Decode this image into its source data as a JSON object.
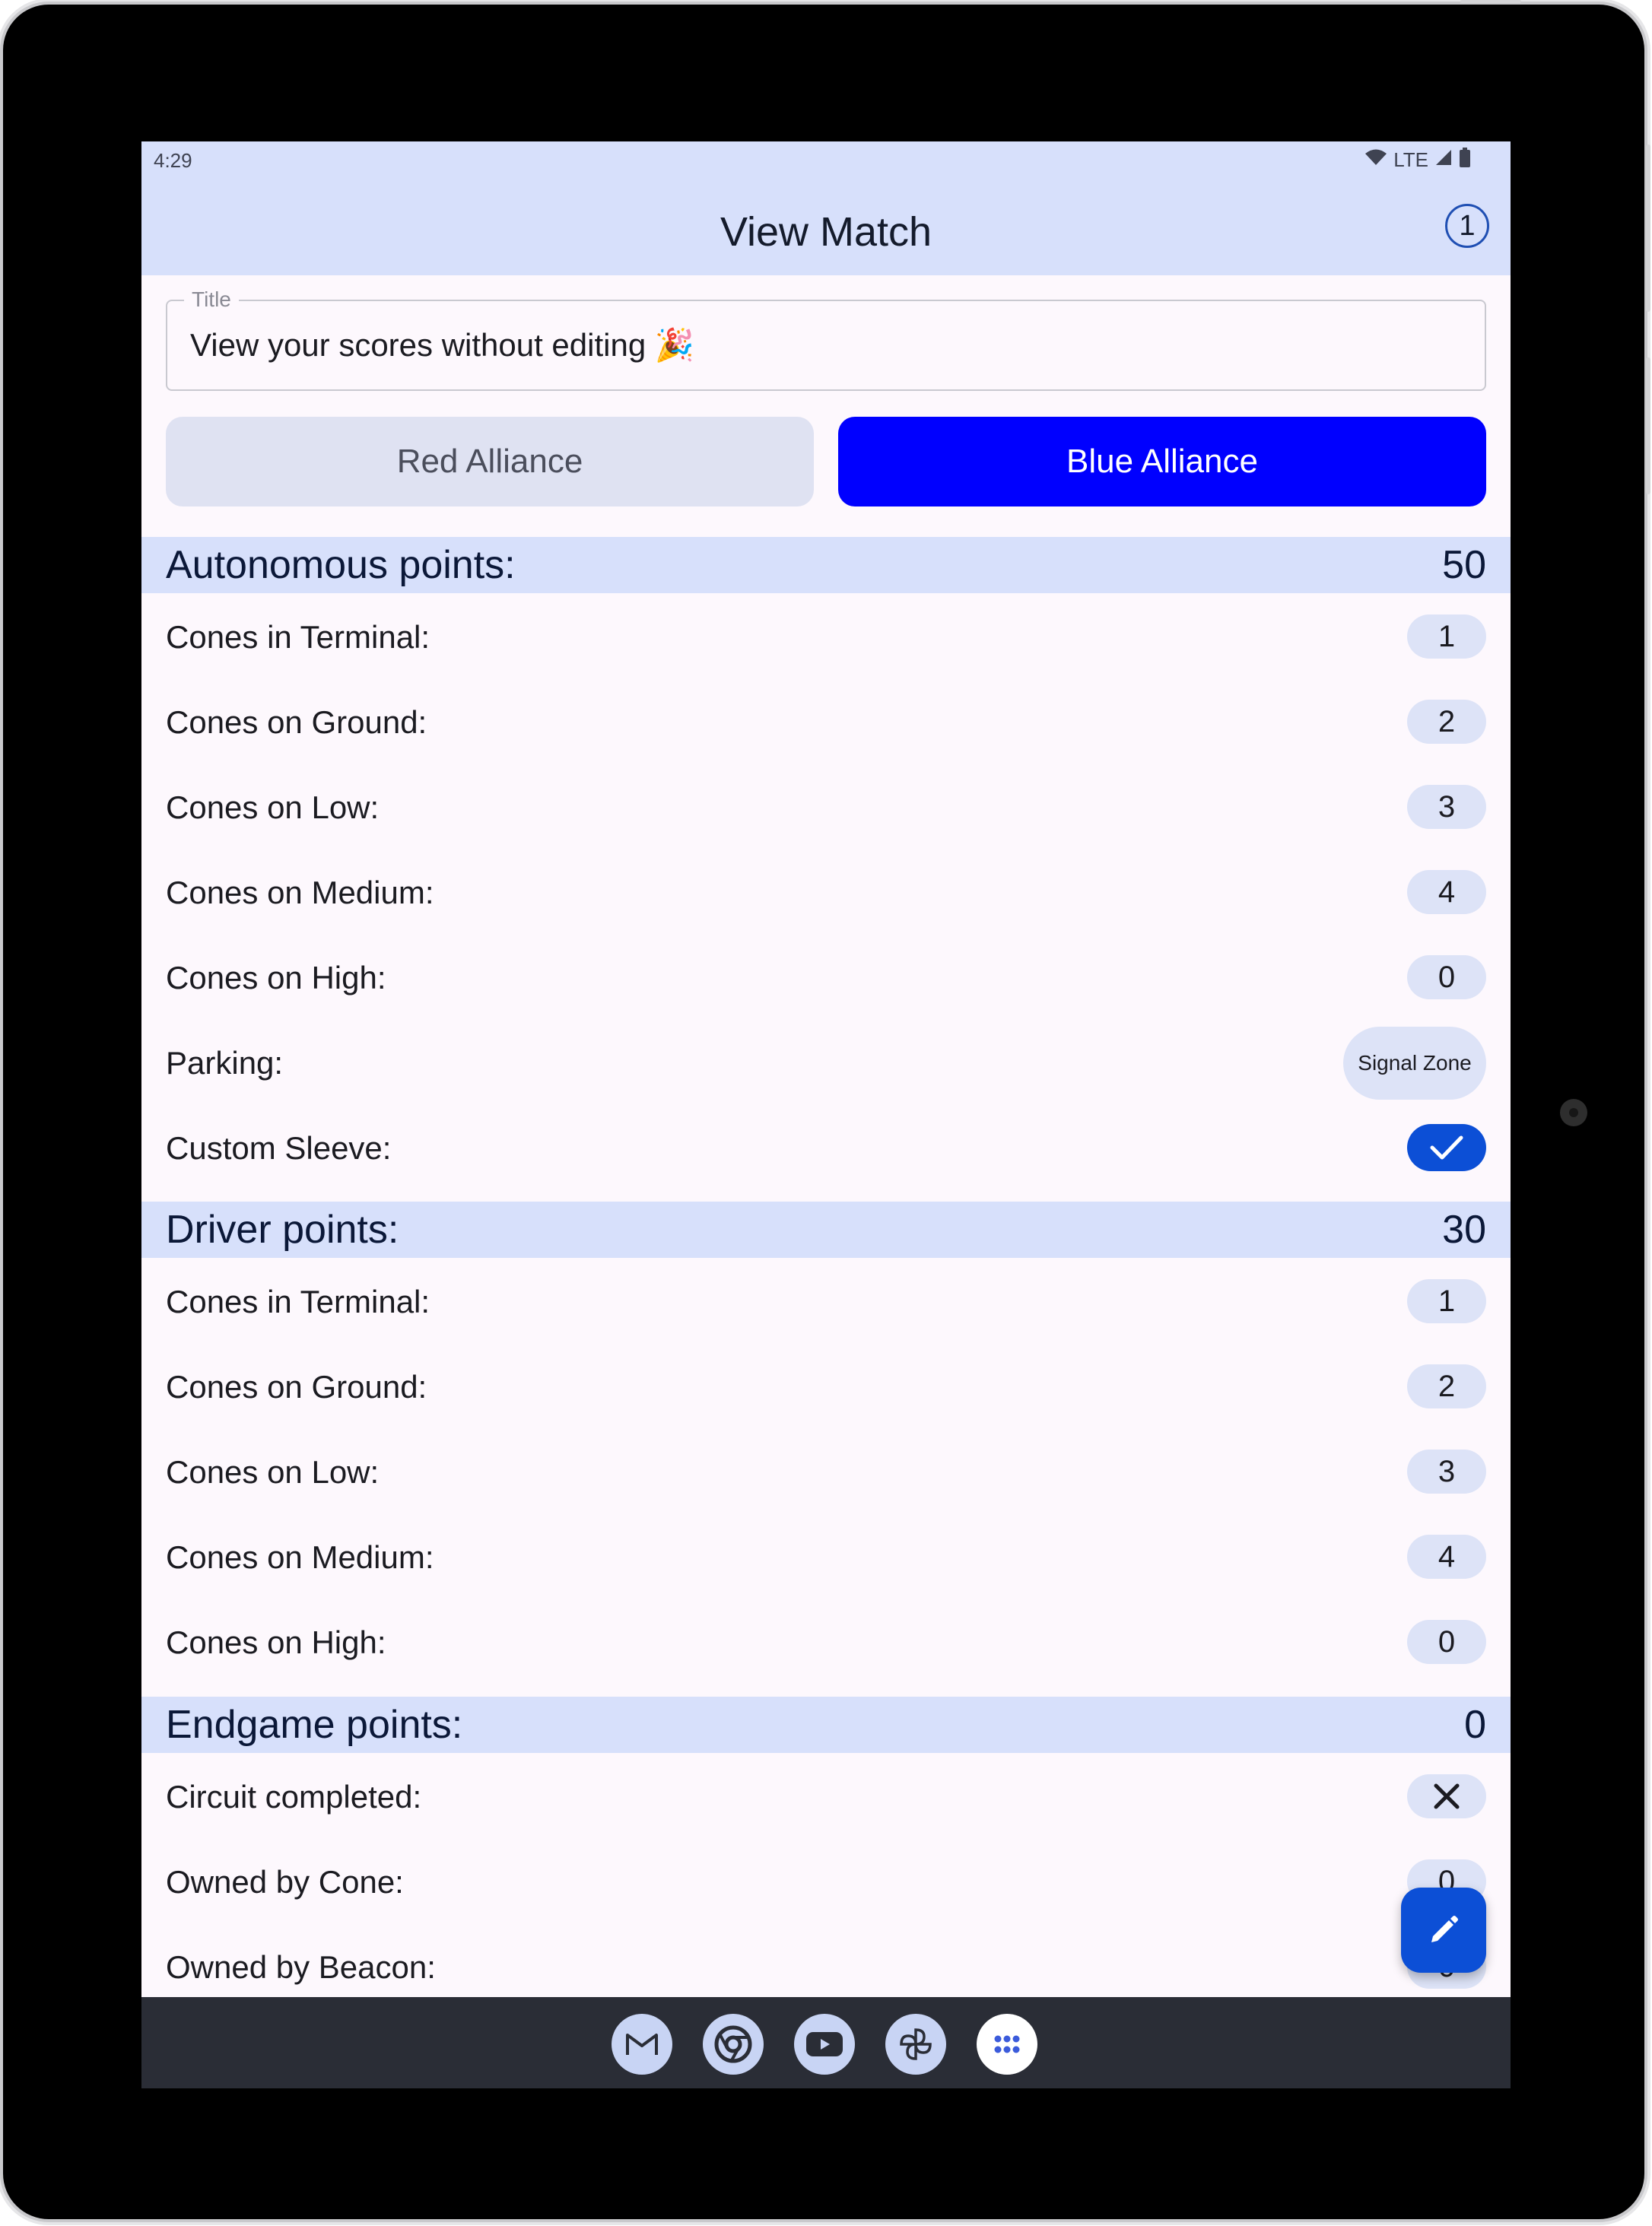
{
  "status": {
    "time": "4:29",
    "network": "LTE"
  },
  "appbar": {
    "title": "View Match",
    "badge": "1"
  },
  "title_field": {
    "label": "Title",
    "value": "View your scores without editing 🎉"
  },
  "alliance": {
    "red_label": "Red Alliance",
    "blue_label": "Blue Alliance",
    "selected": "Blue Alliance"
  },
  "autonomous": {
    "title": "Autonomous points:",
    "total": "50",
    "rows": [
      {
        "label": "Cones in Terminal:",
        "value": "1"
      },
      {
        "label": "Cones on Ground:",
        "value": "2"
      },
      {
        "label": "Cones on Low:",
        "value": "3"
      },
      {
        "label": "Cones on Medium:",
        "value": "4"
      },
      {
        "label": "Cones on High:",
        "value": "0"
      },
      {
        "label": "Parking:",
        "value": "Signal Zone"
      },
      {
        "label": "Custom Sleeve:",
        "value": "checked"
      }
    ]
  },
  "driver": {
    "title": "Driver points:",
    "total": "30",
    "rows": [
      {
        "label": "Cones in Terminal:",
        "value": "1"
      },
      {
        "label": "Cones on Ground:",
        "value": "2"
      },
      {
        "label": "Cones on Low:",
        "value": "3"
      },
      {
        "label": "Cones on Medium:",
        "value": "4"
      },
      {
        "label": "Cones on High:",
        "value": "0"
      }
    ]
  },
  "endgame": {
    "title": "Endgame points:",
    "total": "0",
    "rows": [
      {
        "label": "Circuit completed:",
        "value": "unchecked"
      },
      {
        "label": "Owned by Cone:",
        "value": "0"
      },
      {
        "label": "Owned by Beacon:",
        "value": "0"
      }
    ]
  },
  "fab": {
    "icon": "edit-pencil-icon"
  },
  "dock": {
    "apps": [
      "gmail-icon",
      "chrome-icon",
      "youtube-icon",
      "photos-icon",
      "app-drawer-icon"
    ]
  },
  "colors": {
    "header_bg": "#d7e0fb",
    "blue_alliance": "#0000ff",
    "accent": "#0c4fd6",
    "screen_bg": "#fdf8fd"
  }
}
